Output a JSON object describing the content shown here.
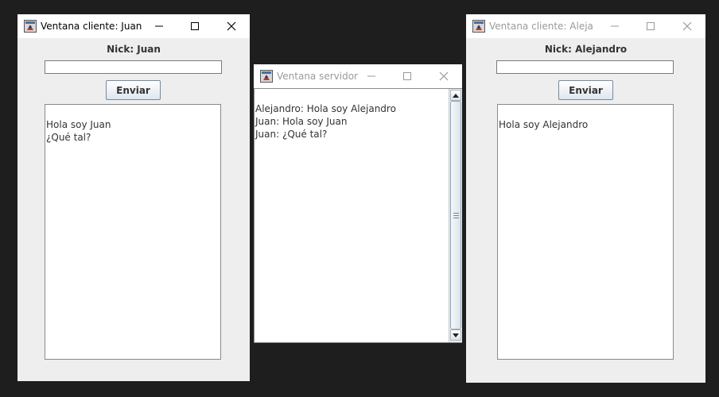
{
  "client1": {
    "title": "Ventana cliente: Juan",
    "nick_label": "Nick: Juan",
    "input_value": "",
    "send_label": "Enviar",
    "messages": [
      "Hola soy Juan",
      "¿Qué tal?"
    ]
  },
  "server": {
    "title": "Ventana servidor",
    "messages": [
      "Alejandro: Hola soy Alejandro",
      "Juan: Hola soy Juan",
      "Juan: ¿Qué tal?"
    ]
  },
  "client2": {
    "title": "Ventana cliente: Alejan...",
    "nick_label": "Nick: Alejandro",
    "input_value": "",
    "send_label": "Enviar",
    "messages": [
      "Hola soy Alejandro"
    ]
  },
  "icons": {
    "app": "java-app-icon",
    "minimize": "minimize-icon",
    "maximize": "maximize-icon",
    "close": "close-icon"
  },
  "colors": {
    "desktop": "#1e1e1e",
    "window_bg": "#eeeeee",
    "titlebar": "#ffffff",
    "inactive_title": "#9a9a9a"
  }
}
